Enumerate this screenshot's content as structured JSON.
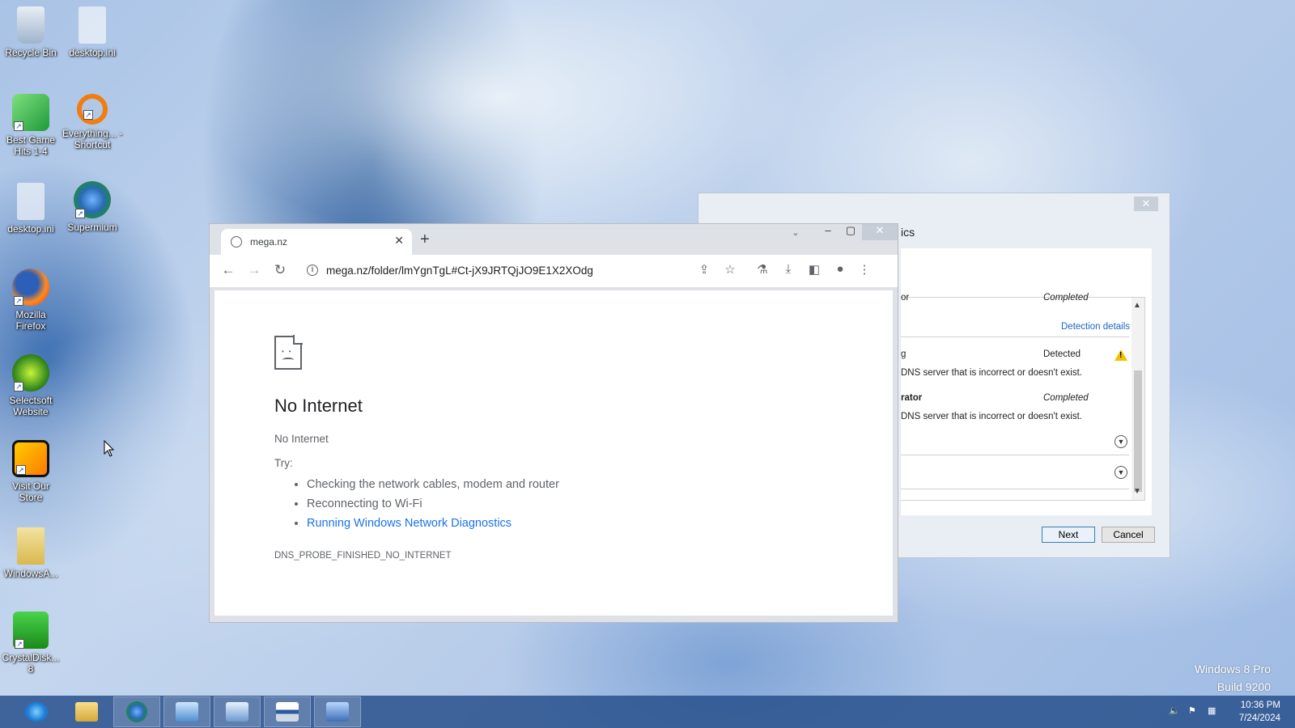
{
  "desktop": {
    "icons": [
      {
        "label": "Recycle Bin"
      },
      {
        "label": "desktop.ini"
      },
      {
        "label": "Best Game Hits 1-4"
      },
      {
        "label": "Everything... - Shortcut"
      },
      {
        "label": "desktop.ini"
      },
      {
        "label": "Supermium"
      },
      {
        "label": "Mozilla Firefox"
      },
      {
        "label": "Selectsoft Website"
      },
      {
        "label": "Visit Our Store"
      },
      {
        "label": "WindowsA..."
      },
      {
        "label": "CrystalDisk... 8"
      }
    ],
    "watermark": {
      "line1": "Windows 8 Pro",
      "line2": "Build 9200"
    }
  },
  "diagnostics": {
    "title_fragment": "ics",
    "rows": {
      "r1_status": "Completed",
      "r1_name_frag": "or",
      "detection_details": "Detection details",
      "r2_name_frag": "g",
      "r2_status": "Detected",
      "r2_desc": "DNS server that is incorrect or doesn't exist.",
      "r3_name_frag": "rator",
      "r3_status": "Completed",
      "r3_desc": "DNS server that is incorrect or doesn't exist."
    },
    "next_label": "Next",
    "cancel_label": "Cancel"
  },
  "browser": {
    "tab_title": "mega.nz",
    "url": "mega.nz/folder/lmYgnTgL#Ct-jX9JRTQjJO9E1X2XOdg",
    "error": {
      "heading": "No Internet",
      "subtitle": "No Internet",
      "try_label": "Try:",
      "suggestions": [
        "Checking the network cables, modem and router",
        "Reconnecting to Wi-Fi",
        "Running Windows Network Diagnostics"
      ],
      "code": "DNS_PROBE_FINISHED_NO_INTERNET"
    }
  },
  "taskbar": {
    "time": "10:36 PM",
    "date": "7/24/2024"
  },
  "colors": {
    "link": "#1a73e8",
    "taskbar": "#28508c",
    "warning": "#f2c200"
  }
}
